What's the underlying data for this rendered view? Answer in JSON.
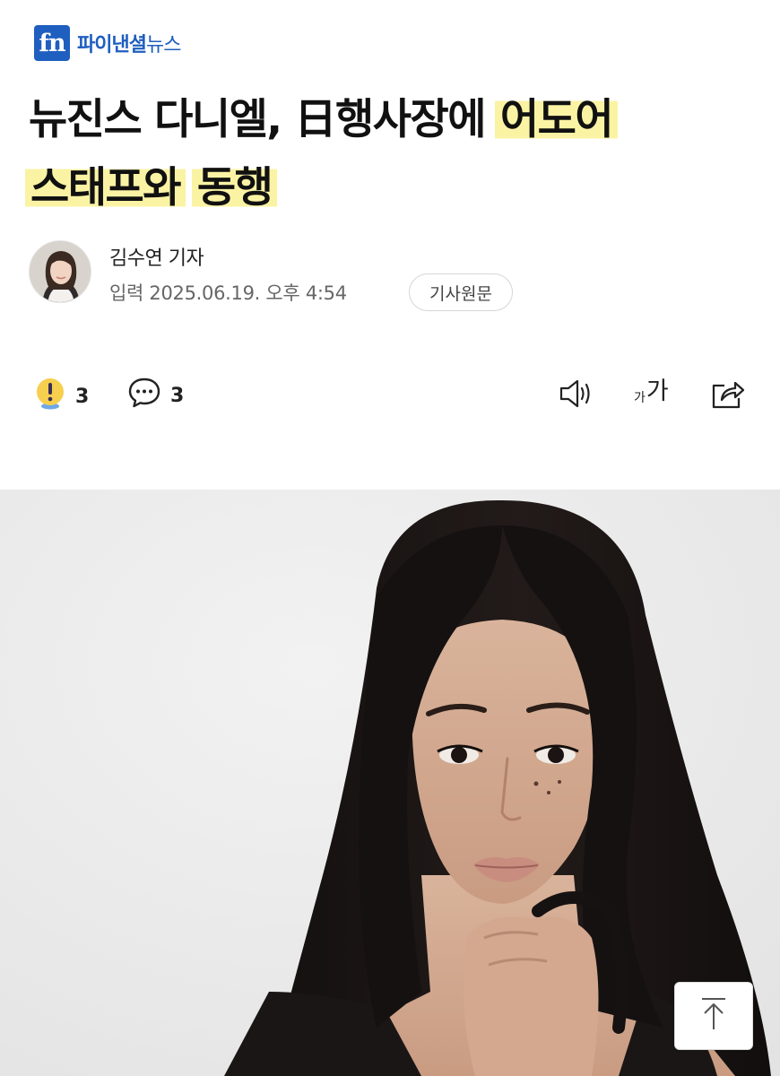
{
  "brand": {
    "mark": "fn",
    "name_bold": "파이낸셜",
    "name_light": "뉴스",
    "color": "#1f5fbf"
  },
  "article": {
    "title_plain_line1": "뉴진스 다니엘, 日행사장에 ",
    "title_highlight_line1": "어도어",
    "title_highlight_line2a": "스태프와",
    "title_highlight_line2b": "동행",
    "highlight_color": "#fbf3a4",
    "author": "김수연 기자",
    "meta": "입력 2025.06.19. 오후 4:54",
    "original_button": "기사원문"
  },
  "actions": {
    "reaction_count": "3",
    "comment_count": "3",
    "icons": [
      "exclamation-reaction-icon",
      "comment-bubble-icon",
      "speaker-icon",
      "font-size-icon",
      "share-icon",
      "arrow-up-icon"
    ],
    "font_small": "가",
    "font_large": "가"
  }
}
